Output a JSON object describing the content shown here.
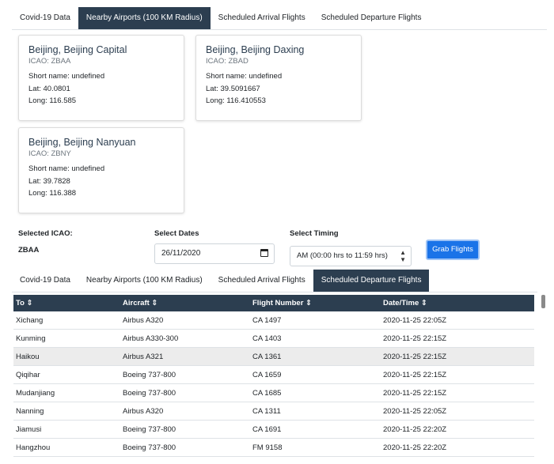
{
  "tabs": [
    "Covid-19 Data",
    "Nearby Airports (100 KM Radius)",
    "Scheduled Arrival Flights",
    "Scheduled Departure Flights"
  ],
  "top_active_tab": "Nearby Airports (100 KM Radius)",
  "bottom_active_tab": "Scheduled Departure Flights",
  "airports": [
    {
      "name": "Beijing, Beijing Capital",
      "icao": "ICAO: ZBAA",
      "short": "Short name: undefined",
      "lat": "Lat: 40.0801",
      "long": "Long: 116.585"
    },
    {
      "name": "Beijing, Beijing Daxing",
      "icao": "ICAO: ZBAD",
      "short": "Short name: undefined",
      "lat": "Lat: 39.5091667",
      "long": "Long: 116.410553"
    },
    {
      "name": "Beijing, Beijing Nanyuan",
      "icao": "ICAO: ZBNY",
      "short": "Short name: undefined",
      "lat": "Lat: 39.7828",
      "long": "Long: 116.388"
    }
  ],
  "form": {
    "selected_icao_label": "Selected ICAO:",
    "selected_icao_value": "ZBAA",
    "dates_label": "Select Dates",
    "date_value": "26/11/2020",
    "timing_label": "Select Timing",
    "timing_value": "AM (00:00 hrs to 11:59 hrs)",
    "button": "Grab Flights"
  },
  "table": {
    "columns": [
      "To ⇕",
      "Aircraft ⇕",
      "Flight Number ⇕",
      "Date/Time ⇕"
    ],
    "rows": [
      [
        "Xichang",
        "Airbus A320",
        "CA 1497",
        "2020-11-25 22:05Z"
      ],
      [
        "Kunming",
        "Airbus A330-300",
        "CA 1403",
        "2020-11-25 22:15Z"
      ],
      [
        "Haikou",
        "Airbus A321",
        "CA 1361",
        "2020-11-25 22:15Z"
      ],
      [
        "Qiqihar",
        "Boeing 737-800",
        "CA 1659",
        "2020-11-25 22:15Z"
      ],
      [
        "Mudanjiang",
        "Boeing 737-800",
        "CA 1685",
        "2020-11-25 22:15Z"
      ],
      [
        "Nanning",
        "Airbus A320",
        "CA 1311",
        "2020-11-25 22:05Z"
      ],
      [
        "Jiamusi",
        "Boeing 737-800",
        "CA 1691",
        "2020-11-25 22:20Z"
      ],
      [
        "Hangzhou",
        "Boeing 737-800",
        "FM 9158",
        "2020-11-25 22:20Z"
      ]
    ]
  }
}
